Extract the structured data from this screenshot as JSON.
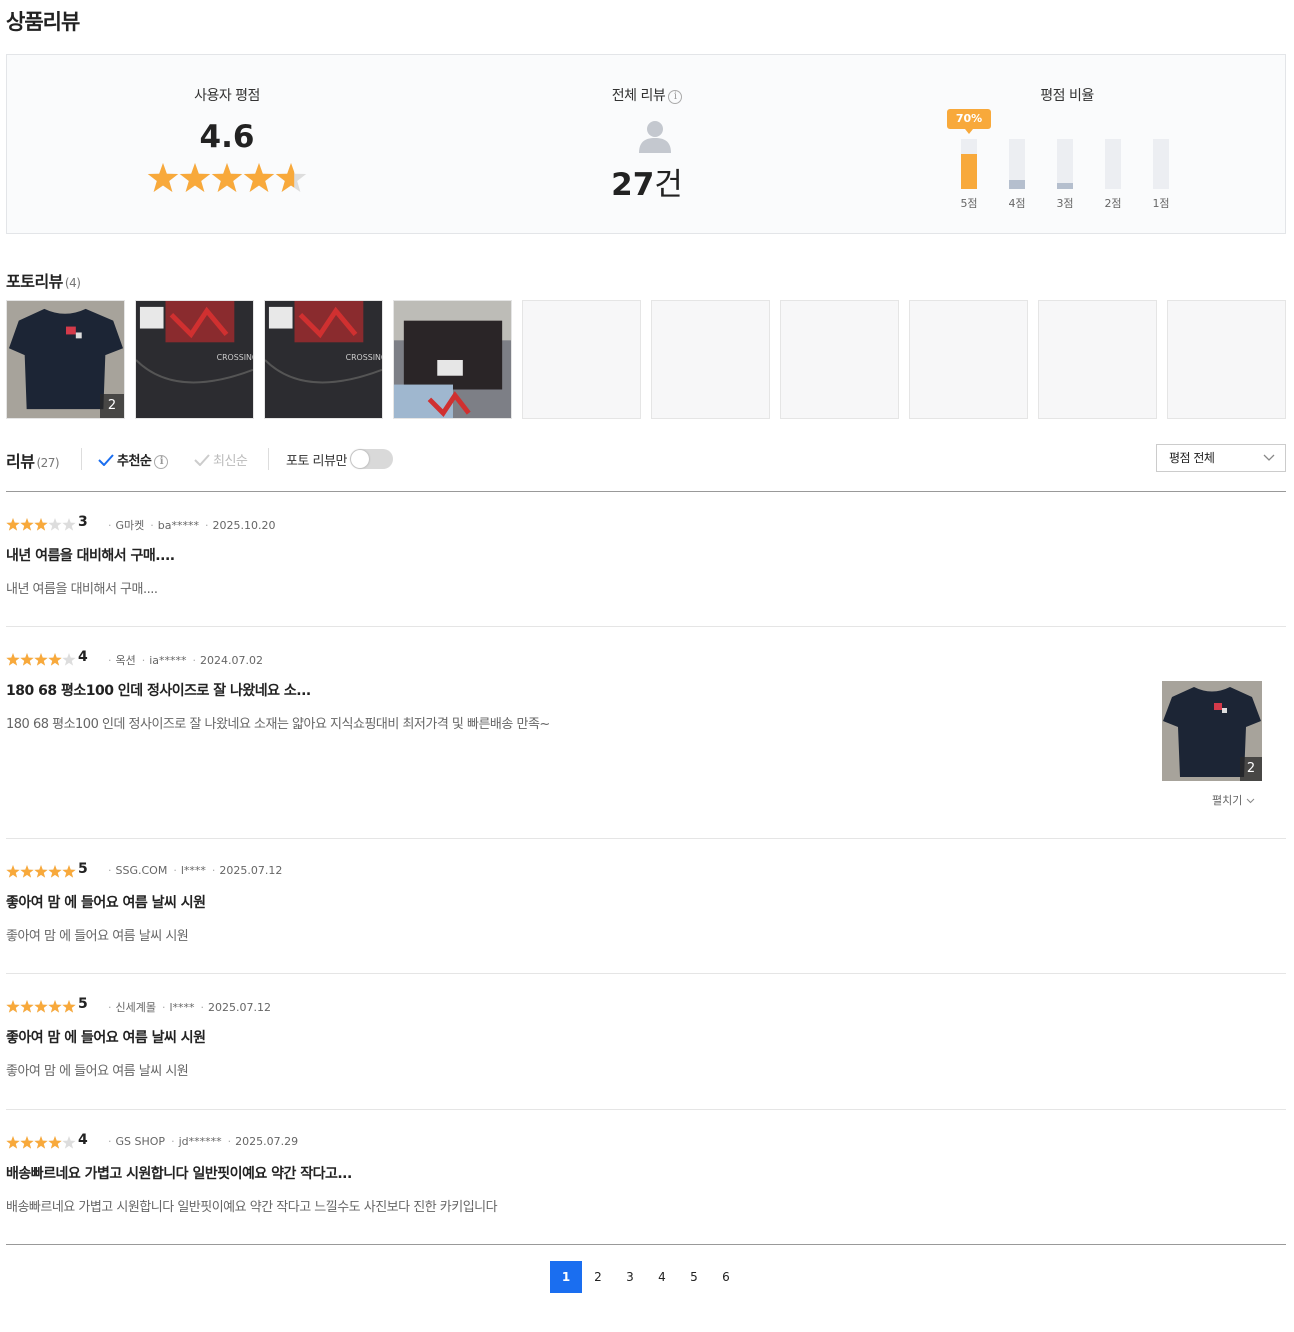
{
  "page": {
    "title": "상품리뷰"
  },
  "summary": {
    "user_rating": {
      "label": "사용자 평점",
      "score": "4.6",
      "stars": 4.6
    },
    "total_reviews": {
      "label": "전체 리뷰",
      "count": "27",
      "unit": "건"
    },
    "rating_ratio": {
      "label": "평점 비율",
      "top_percent": "70%",
      "bars": [
        {
          "label": "5점",
          "value": 70,
          "color": "#f8a93b"
        },
        {
          "label": "4점",
          "value": 18,
          "color": "#b5bfce"
        },
        {
          "label": "3점",
          "value": 12,
          "color": "#b5bfce"
        },
        {
          "label": "2점",
          "value": 0,
          "color": "#b5bfce"
        },
        {
          "label": "1점",
          "value": 0,
          "color": "#b5bfce"
        }
      ]
    }
  },
  "photo_reviews": {
    "label": "포토리뷰",
    "count": "(4)",
    "first_thumb_count": "2"
  },
  "review_list": {
    "label": "리뷰",
    "count": "(27)",
    "sort_recommended": "추천순",
    "sort_latest": "최신순",
    "photo_only": "포토 리뷰만",
    "rating_filter": "평점 전체"
  },
  "reviews": [
    {
      "stars": 3,
      "score": "3",
      "source": "G마켓",
      "user": "ba*****",
      "date": "2025.10.20",
      "title": "내년 여름을 대비해서 구매....",
      "body": "내년 여름을 대비해서 구매...."
    },
    {
      "stars": 4,
      "score": "4",
      "source": "옥션",
      "user": "ia*****",
      "date": "2024.07.02",
      "title": "180 68 평소100 인데 정사이즈로 잘 나왔네요 소...",
      "body": "180 68 평소100 인데 정사이즈로 잘 나왔네요 소재는 얇아요 지식쇼핑대비 최저가격 및 빠른배송 만족~",
      "photo_count": "2",
      "expand": "펼치기"
    },
    {
      "stars": 5,
      "score": "5",
      "source": "SSG.COM",
      "user": "l****",
      "date": "2025.07.12",
      "title": "좋아여 맘 에 들어요 여름 날씨 시원",
      "body": "좋아여 맘 에 들어요 여름 날씨 시원"
    },
    {
      "stars": 5,
      "score": "5",
      "source": "신세계몰",
      "user": "l****",
      "date": "2025.07.12",
      "title": "좋아여 맘 에 들어요 여름 날씨 시원",
      "body": "좋아여 맘 에 들어요 여름 날씨 시원"
    },
    {
      "stars": 4,
      "score": "4",
      "source": "GS SHOP",
      "user": "jd******",
      "date": "2025.07.29",
      "title": "배송빠르네요 가볍고 시원합니다 일반핏이예요 약간 작다고...",
      "body": "배송빠르네요 가볍고 시원합니다 일반핏이예요 약간 작다고 느낄수도 사진보다 진한 카키입니다"
    }
  ],
  "pagination": {
    "pages": [
      "1",
      "2",
      "3",
      "4",
      "5",
      "6"
    ],
    "current": "1"
  },
  "colors": {
    "star": "#f8a93b",
    "star_empty": "#dddddd",
    "accent": "#1a6ef0"
  },
  "icons": [
    "info-icon",
    "user-icon",
    "check-icon",
    "chevron-down-icon",
    "star-icon"
  ]
}
